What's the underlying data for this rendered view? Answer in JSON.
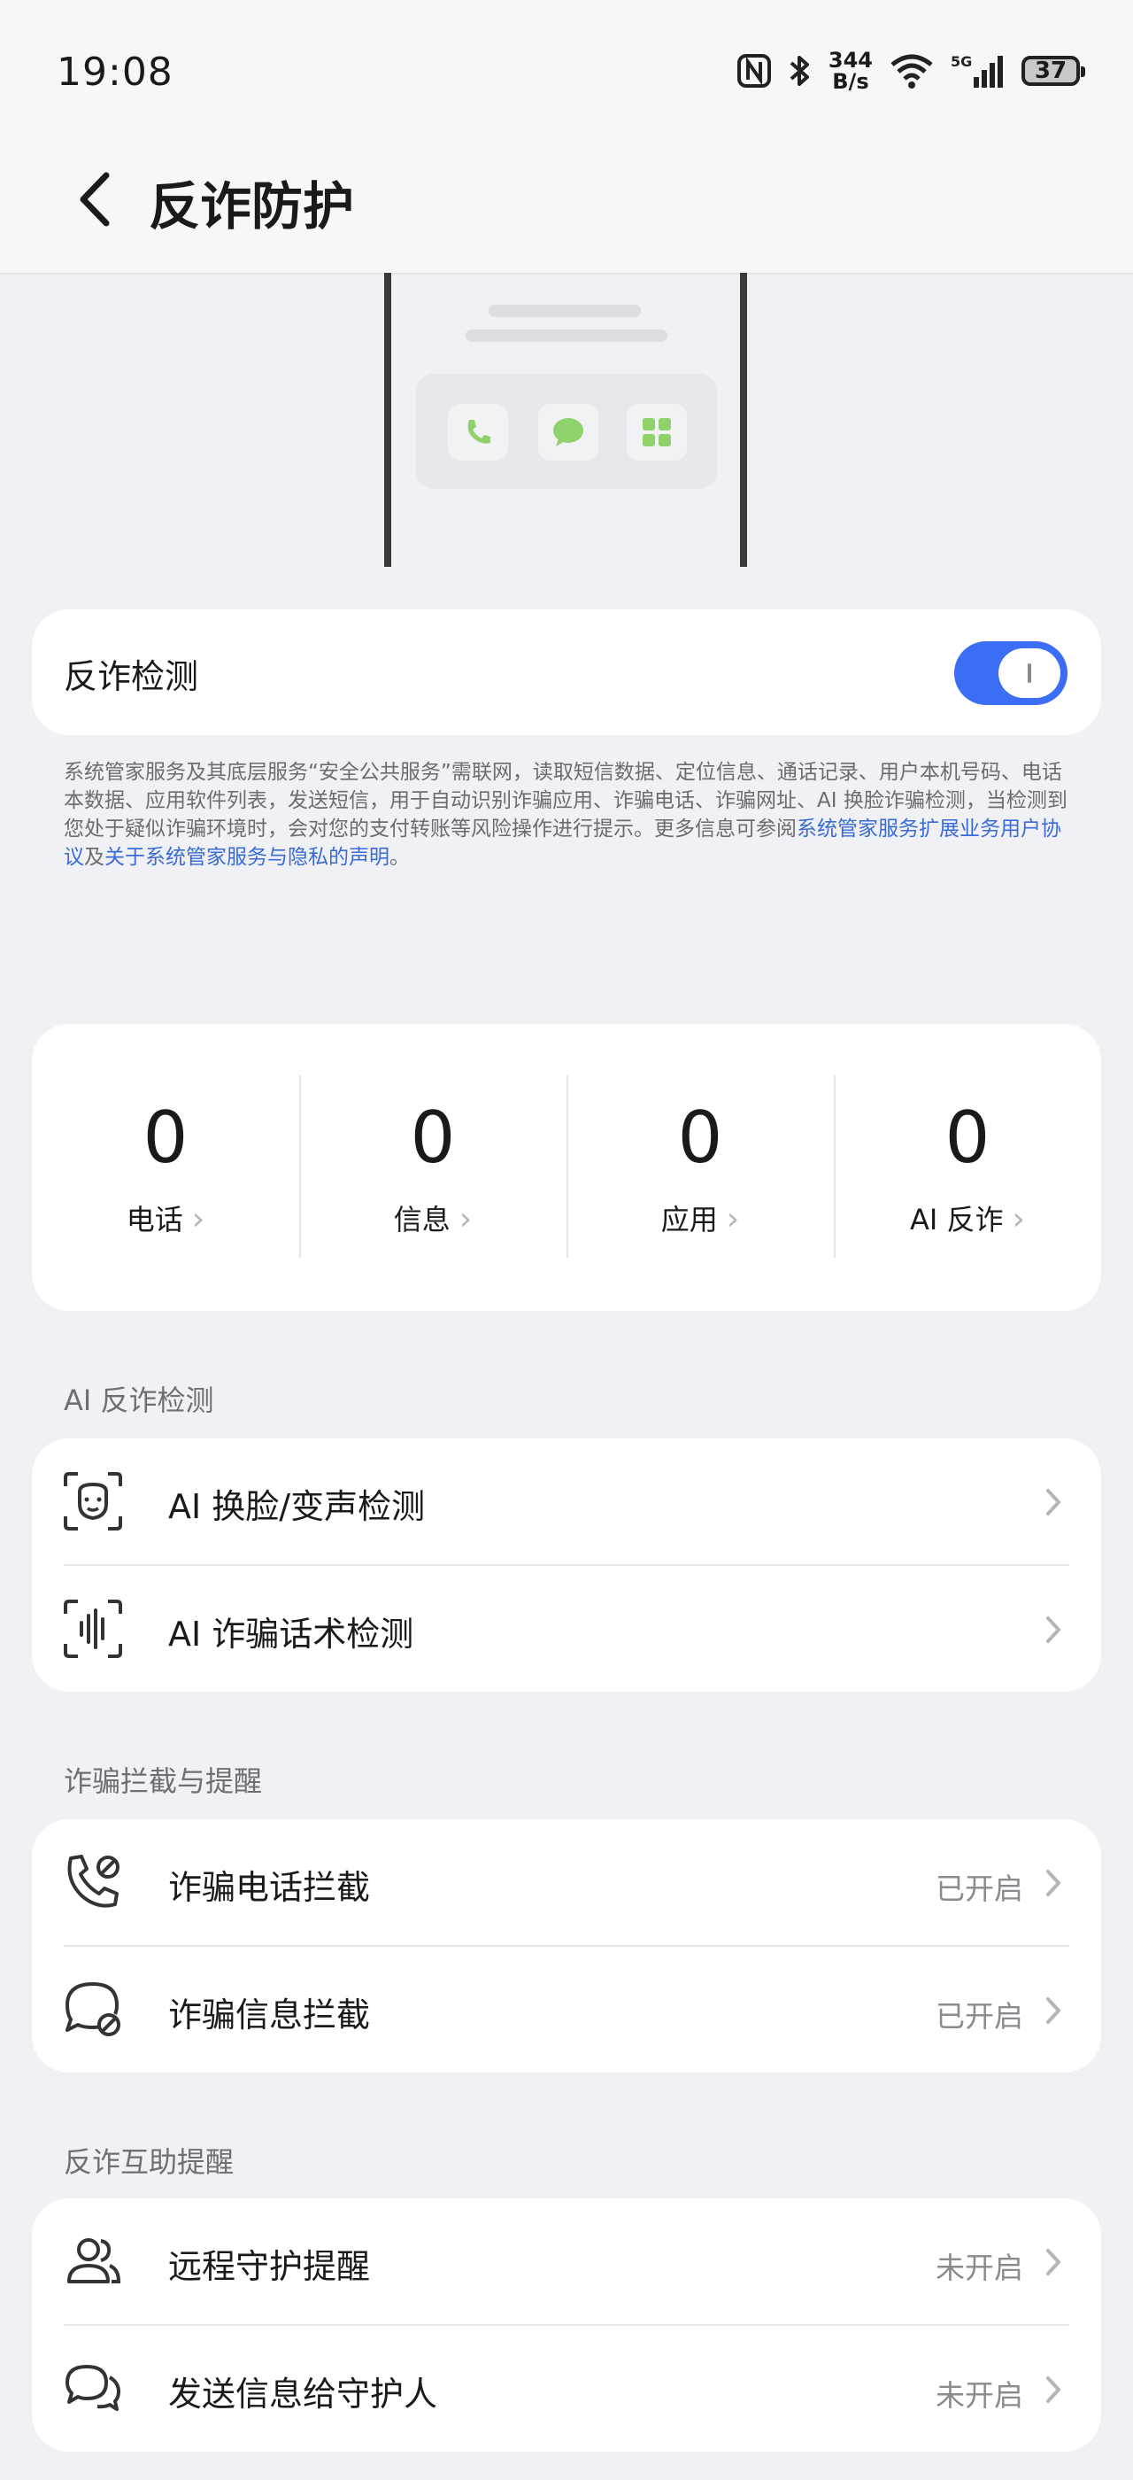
{
  "status_bar": {
    "time": "19:08",
    "net_speed_value": "344",
    "net_speed_unit": "B/s",
    "battery": "37",
    "icons": [
      "nfc-icon",
      "bluetooth-icon",
      "wifi-icon",
      "cellular-5g-icon",
      "battery-icon"
    ]
  },
  "header": {
    "title": "反诈防护"
  },
  "illustration": {
    "icons": [
      "phone-icon",
      "message-icon",
      "apps-icon"
    ],
    "accent": "#8fd16a"
  },
  "detection": {
    "label": "反诈检测",
    "enabled": true,
    "accent": "#3c6ef5"
  },
  "notice": {
    "text": "系统管家服务及其底层服务“安全公共服务”需联网，读取短信数据、定位信息、通话记录、用户本机号码、电话本数据、应用软件列表，发送短信，用于自动识别诈骗应用、诈骗电话、诈骗网址、AI 换脸诈骗检测，当检测到您处于疑似诈骗环境时，会对您的支付转账等风险操作进行提示。更多信息可参阅",
    "link1": "系统管家服务扩展业务用户协议",
    "joiner": "及",
    "link2": "关于系统管家服务与隐私的声明",
    "end": "。"
  },
  "stats": [
    {
      "value": "0",
      "label": "电话"
    },
    {
      "value": "0",
      "label": "信息"
    },
    {
      "value": "0",
      "label": "应用"
    },
    {
      "value": "0",
      "label": "AI 反诈"
    }
  ],
  "sections": [
    {
      "title": "AI 反诈检测",
      "items": [
        {
          "label": "AI 换脸/变声检测",
          "status": "",
          "icon": "face-scan-icon"
        },
        {
          "label": "AI 诈骗话术检测",
          "status": "",
          "icon": "voice-scan-icon"
        }
      ]
    },
    {
      "title": "诈骗拦截与提醒",
      "items": [
        {
          "label": "诈骗电话拦截",
          "status": "已开启",
          "icon": "phone-block-icon"
        },
        {
          "label": "诈骗信息拦截",
          "status": "已开启",
          "icon": "message-block-icon"
        }
      ]
    },
    {
      "title": "反诈互助提醒",
      "items": [
        {
          "label": "远程守护提醒",
          "status": "未开启",
          "icon": "guardians-icon"
        },
        {
          "label": "发送信息给守护人",
          "status": "未开启",
          "icon": "chat-bubbles-icon"
        }
      ]
    }
  ]
}
